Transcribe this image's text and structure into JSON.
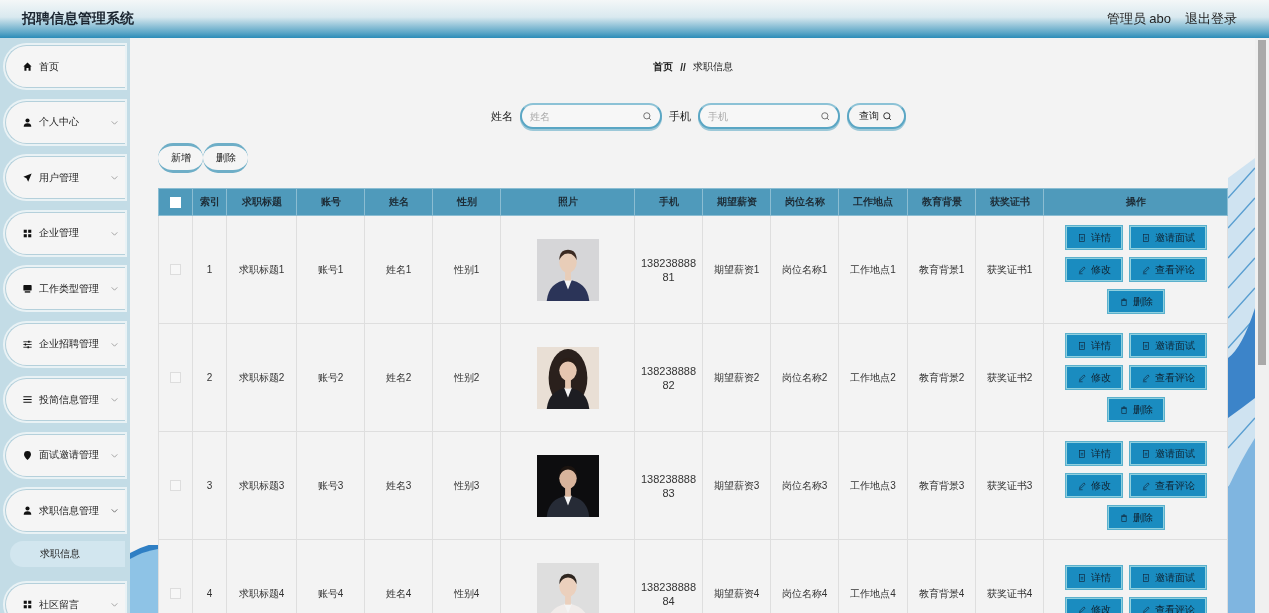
{
  "header": {
    "title": "招聘信息管理系统",
    "user": "管理员 abo",
    "logout": "退出登录"
  },
  "sidebar": {
    "items": [
      {
        "label": "首页",
        "selected": false
      },
      {
        "label": "个人中心",
        "selected": false,
        "expanded": false
      },
      {
        "label": "用户管理",
        "selected": false,
        "expanded": false
      },
      {
        "label": "企业管理",
        "selected": false,
        "expanded": false
      },
      {
        "label": "工作类型管理",
        "selected": false,
        "expanded": false
      },
      {
        "label": "企业招聘管理",
        "selected": false,
        "expanded": false
      },
      {
        "label": "投简信息管理",
        "selected": false,
        "expanded": false
      },
      {
        "label": "面试邀请管理",
        "selected": false,
        "expanded": false
      },
      {
        "label": "求职信息管理",
        "selected": false,
        "expanded": true,
        "children": [
          {
            "label": "求职信息",
            "selected": true
          }
        ]
      },
      {
        "label": "社区留言",
        "selected": false,
        "expanded": false
      }
    ]
  },
  "breadcrumb": {
    "home": "首页",
    "separator": "//",
    "current": "求职信息"
  },
  "search": {
    "fields": [
      {
        "label": "姓名",
        "placeholder": "姓名"
      },
      {
        "label": "手机",
        "placeholder": "手机"
      }
    ],
    "button": "查询"
  },
  "toolbar": [
    "新增",
    "删除"
  ],
  "table": {
    "select_all": {
      "checked": false
    },
    "columns": [
      "索引",
      "求职标题",
      "账号",
      "姓名",
      "性别",
      "照片",
      "手机",
      "期望薪资",
      "岗位名称",
      "工作地点",
      "教育背景",
      "获奖证书",
      "操作"
    ],
    "rows": [
      {
        "checked": false,
        "cells": [
          "1",
          "求职标题1",
          "账号1",
          "姓名1",
          "性别1",
          {
            "kind": "picture"
          },
          "13823888881",
          "期望薪资1",
          "岗位名称1",
          "工作地点1",
          "教育背景1",
          "获奖证书1"
        ],
        "actions": [
          {
            "label": "详情",
            "kind": "doc"
          },
          {
            "label": "邀请面试",
            "kind": "doc"
          },
          {
            "label": "修改",
            "kind": "pen"
          },
          {
            "label": "查看评论",
            "kind": "pen"
          },
          {
            "label": "删除",
            "kind": "trash"
          }
        ]
      },
      {
        "checked": false,
        "cells": [
          "2",
          "求职标题2",
          "账号2",
          "姓名2",
          "性别2",
          {
            "kind": "picture"
          },
          "13823888882",
          "期望薪资2",
          "岗位名称2",
          "工作地点2",
          "教育背景2",
          "获奖证书2"
        ],
        "actions": [
          {
            "label": "详情",
            "kind": "doc"
          },
          {
            "label": "邀请面试",
            "kind": "doc"
          },
          {
            "label": "修改",
            "kind": "pen"
          },
          {
            "label": "查看评论",
            "kind": "pen"
          },
          {
            "label": "删除",
            "kind": "trash"
          }
        ]
      },
      {
        "checked": false,
        "cells": [
          "3",
          "求职标题3",
          "账号3",
          "姓名3",
          "性别3",
          {
            "kind": "picture"
          },
          "13823888883",
          "期望薪资3",
          "岗位名称3",
          "工作地点3",
          "教育背景3",
          "获奖证书3"
        ],
        "actions": [
          {
            "label": "详情",
            "kind": "doc"
          },
          {
            "label": "邀请面试",
            "kind": "doc"
          },
          {
            "label": "修改",
            "kind": "pen"
          },
          {
            "label": "查看评论",
            "kind": "pen"
          },
          {
            "label": "删除",
            "kind": "trash"
          }
        ]
      },
      {
        "checked": false,
        "cells": [
          "4",
          "求职标题4",
          "账号4",
          "姓名4",
          "性别4",
          {
            "kind": "picture"
          },
          "13823888884",
          "期望薪资4",
          "岗位名称4",
          "工作地点4",
          "教育背景4",
          "获奖证书4"
        ],
        "actions": [
          {
            "label": "详情",
            "kind": "doc"
          },
          {
            "label": "邀请面试",
            "kind": "doc"
          },
          {
            "label": "修改",
            "kind": "pen"
          },
          {
            "label": "查看评论",
            "kind": "pen"
          }
        ]
      }
    ]
  }
}
